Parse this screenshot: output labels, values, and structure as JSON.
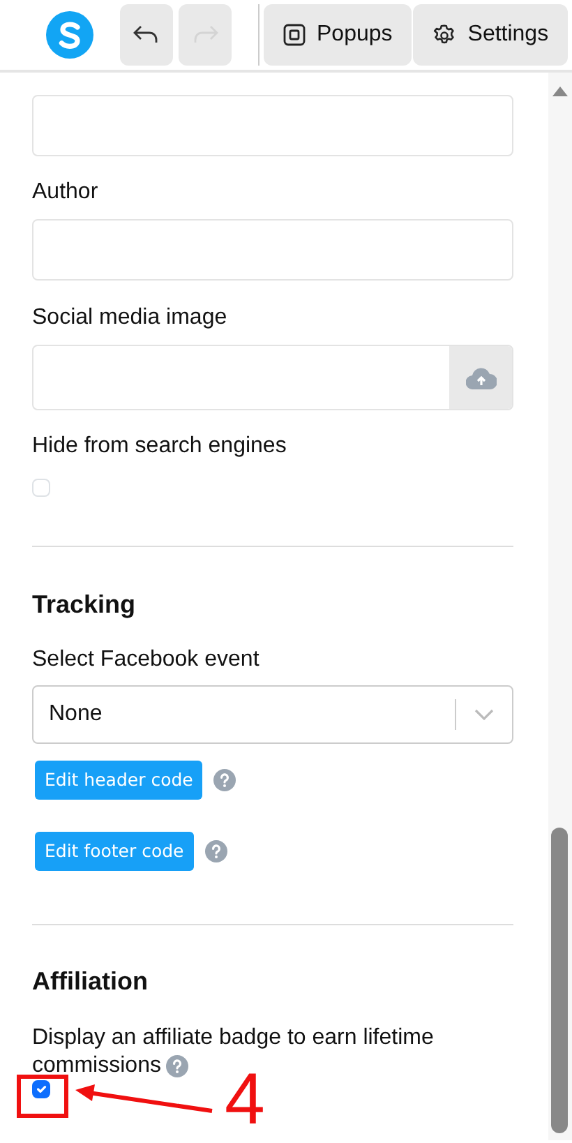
{
  "toolbar": {
    "undo": {
      "disabled": false
    },
    "redo": {
      "disabled": true
    },
    "buttons": [
      {
        "label": "Popups",
        "kind": "popups"
      },
      {
        "label": "Settings",
        "kind": "settings"
      }
    ]
  },
  "fields": [
    {
      "kind": "text"
    },
    {
      "kind": "text",
      "label": "Author"
    },
    {
      "kind": "upload",
      "label": "Social media image"
    },
    {
      "kind": "checkbox",
      "label": "Hide from search engines",
      "checked": false
    }
  ],
  "tracking": {
    "title": "Tracking",
    "select_label": "Select Facebook event",
    "select_value": "None",
    "buttons": [
      {
        "label": "Edit header code"
      },
      {
        "label": "Edit footer code"
      }
    ]
  },
  "affiliation": {
    "title": "Affiliation",
    "text_lines": [
      "Display an affiliate badge to earn lifetime",
      "commissions"
    ],
    "checked": true
  },
  "annotation": {
    "label": "4"
  }
}
